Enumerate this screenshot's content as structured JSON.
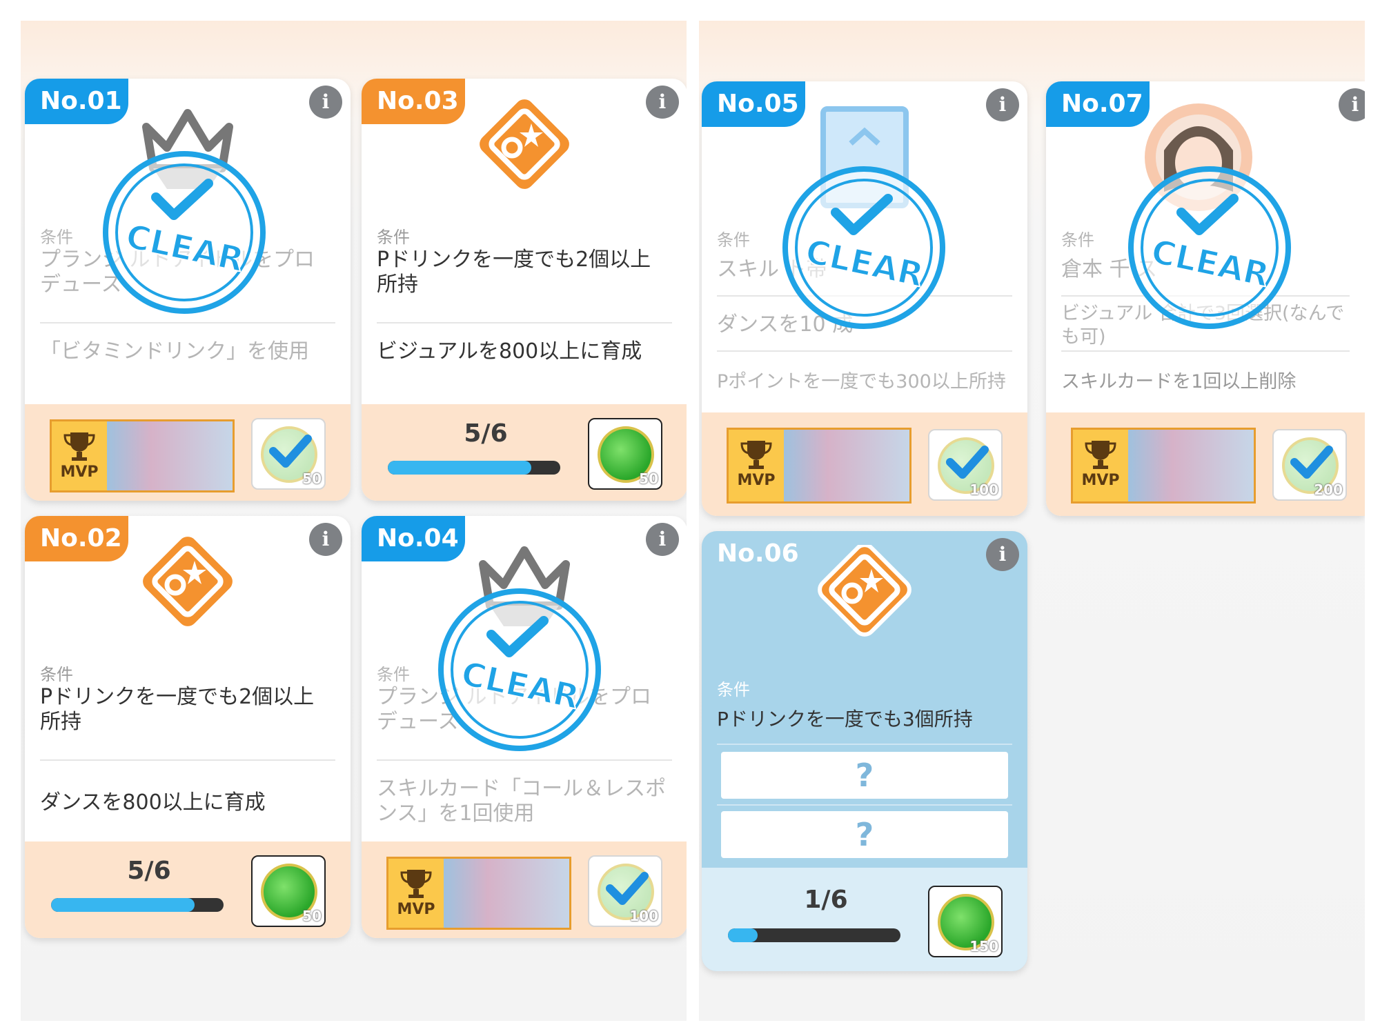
{
  "cards": {
    "c01": {
      "no": "No.01",
      "label": "条件",
      "cond1": "プランジ  ルトアイドルをプロデュース",
      "cond2": "「ビタミンドリンク」を使用",
      "stamp": "CLEAR",
      "reward_amount": "50",
      "mvp": "MVP"
    },
    "c02": {
      "no": "No.02",
      "label": "条件",
      "cond1": "Pドリンクを一度でも2個以上所持",
      "cond2": "ダンスを800以上に育成",
      "progress": "5/6",
      "progress_value": 0.83,
      "reward_amount": "50"
    },
    "c03": {
      "no": "No.03",
      "label": "条件",
      "cond1": "Pドリンクを一度でも2個以上所持",
      "cond2": "ビジュアルを800以上に育成",
      "progress": "5/6",
      "progress_value": 0.83,
      "reward_amount": "50"
    },
    "c04": {
      "no": "No.04",
      "label": "条件",
      "cond1": "プランジ  ルトアイドルをプロデュース",
      "cond2": "スキルカード「コール＆レスポンス」を1回使用",
      "stamp": "CLEAR",
      "reward_amount": "100",
      "mvp": "MVP"
    },
    "c05": {
      "no": "No.05",
      "label": "条件",
      "cond1": "スキル  ト帯",
      "cond2": "ダンスを10  成",
      "cond3": "Pポイントを一度でも300以上所持",
      "stamp": "CLEAR",
      "reward_amount": "100",
      "mvp": "MVP"
    },
    "c06": {
      "no": "No.06",
      "label": "条件",
      "cond1": "Pドリンクを一度でも3個所持",
      "hidden1": "?",
      "hidden2": "?",
      "progress": "1/6",
      "progress_value": 0.17,
      "reward_amount": "150"
    },
    "c07": {
      "no": "No.07",
      "label": "条件",
      "cond1": "倉本 千  ス",
      "cond2": "ビジュアル  合計で3回選択(なんでも可)",
      "cond3": "スキルカードを1回以上削除",
      "stamp": "CLEAR",
      "reward_amount": "200",
      "mvp": "MVP"
    }
  },
  "info_glyph": "i",
  "colors": {
    "blue_badge": "#169ce8",
    "orange_badge": "#f4922f",
    "stamp_blue": "#1fa3e6",
    "footer_orange": "#fde3cc",
    "active_card": "#a8d4ea"
  },
  "icons": [
    "idol-crown-icon",
    "drink-card-icon",
    "frame-icon",
    "character-portrait-icon",
    "medal-icon",
    "trophy-icon",
    "checkmark-icon",
    "clear-stamp-icon"
  ]
}
